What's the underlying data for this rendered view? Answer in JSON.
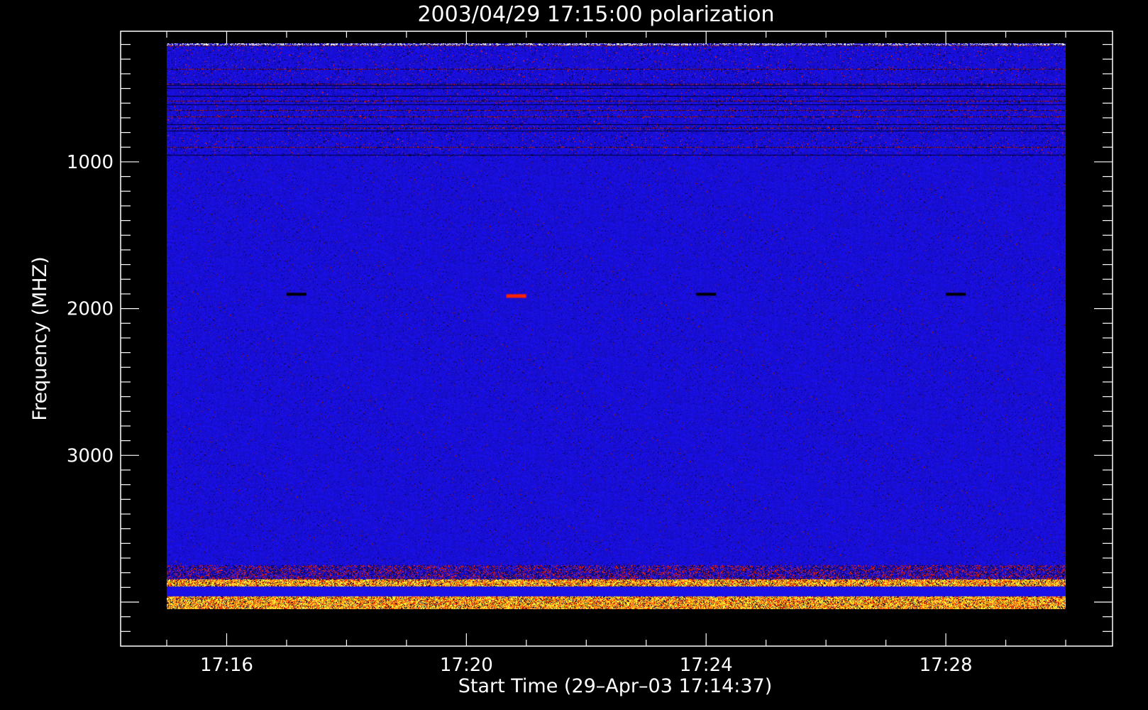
{
  "chart_data": {
    "type": "heatmap",
    "title": "2003/04/29 17:15:00 polarization",
    "xlabel": "Start Time (29–Apr–03 17:14:37)",
    "ylabel": "Frequency (MHZ)",
    "x_tick_labels": [
      "17:16",
      "17:20",
      "17:24",
      "17:28"
    ],
    "y_tick_labels": [
      "1000",
      "2000",
      "3000"
    ],
    "y_tick_values": [
      1000,
      2000,
      3000
    ],
    "ylim": [
      110,
      4300
    ],
    "y_inverted": true,
    "data_extent": {
      "time_start": "17:15:00",
      "time_end": "17:30:00",
      "freq_min": 190,
      "freq_max": 4050
    },
    "colors": {
      "background": "#000000",
      "base": "#1a10e8",
      "dark": "#000030",
      "red": "#ff2200",
      "orange": "#ff8800",
      "yellow": "#ffff40",
      "white": "#ffffff"
    }
  }
}
